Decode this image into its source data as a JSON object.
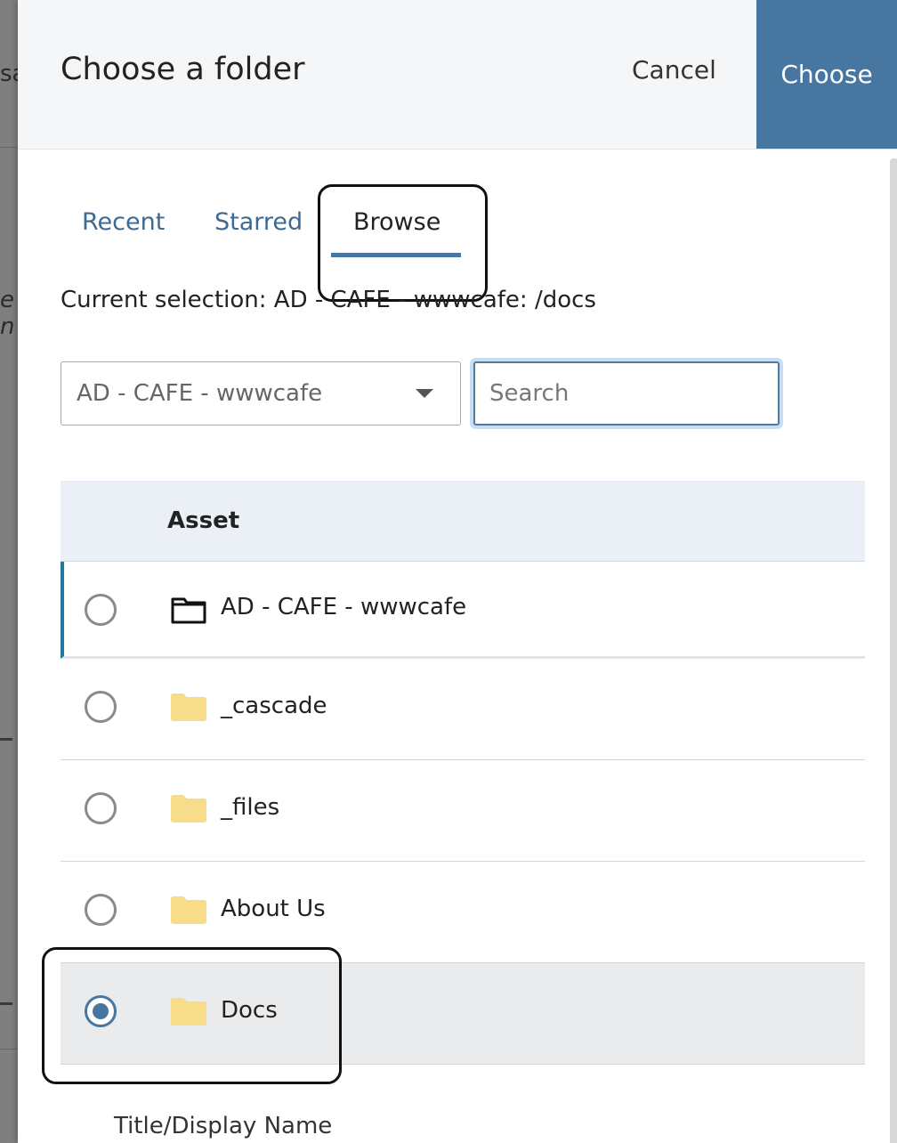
{
  "dialog": {
    "title": "Choose a folder",
    "cancel_label": "Cancel",
    "choose_label": "Choose",
    "accent_color": "#4777a0"
  },
  "tabs": [
    {
      "label": "Recent",
      "active": false
    },
    {
      "label": "Starred",
      "active": false
    },
    {
      "label": "Browse",
      "active": true
    }
  ],
  "current_selection": "Current selection: AD - CAFE - wwwcafe: /docs",
  "site_select": {
    "value": "AD - CAFE - wwwcafe"
  },
  "search": {
    "placeholder": "Search",
    "value": ""
  },
  "table": {
    "header": "Asset",
    "rows": [
      {
        "label": "AD - CAFE - wwwcafe",
        "icon": "folder-outline-icon",
        "checked": false
      },
      {
        "label": "_cascade",
        "icon": "folder-icon",
        "checked": false
      },
      {
        "label": "_files",
        "icon": "folder-icon",
        "checked": false
      },
      {
        "label": "About Us",
        "icon": "folder-icon",
        "checked": false
      },
      {
        "label": "Docs",
        "icon": "folder-icon",
        "checked": true
      }
    ]
  },
  "footer": {
    "label": "Title/Display Name"
  },
  "background_fragments": [
    "sa",
    "e n"
  ]
}
